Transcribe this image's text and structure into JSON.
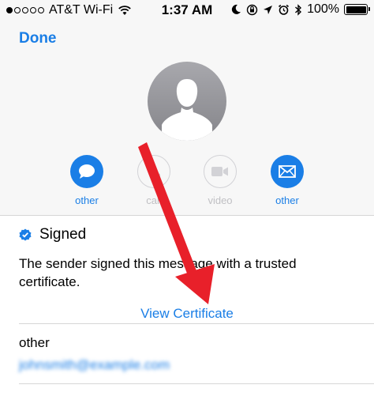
{
  "status_bar": {
    "carrier": "AT&T Wi-Fi",
    "time": "1:37 AM",
    "battery": "100%",
    "signal_dots_filled": 1,
    "signal_dots_total": 5
  },
  "header": {
    "done_label": "Done"
  },
  "actions": [
    {
      "label": "other",
      "icon": "message-icon",
      "enabled": true
    },
    {
      "label": "call",
      "icon": "phone-icon",
      "enabled": false
    },
    {
      "label": "video",
      "icon": "video-icon",
      "enabled": false
    },
    {
      "label": "other",
      "icon": "mail-icon",
      "enabled": true
    }
  ],
  "signature": {
    "label": "Signed",
    "description": "The sender signed this message with a trusted certificate.",
    "view_certificate_label": "View Certificate"
  },
  "email": {
    "label": "other",
    "value": "johnsmith@example.com"
  },
  "colors": {
    "accent": "#1a7ee6",
    "annotation_arrow": "#e8202a"
  }
}
